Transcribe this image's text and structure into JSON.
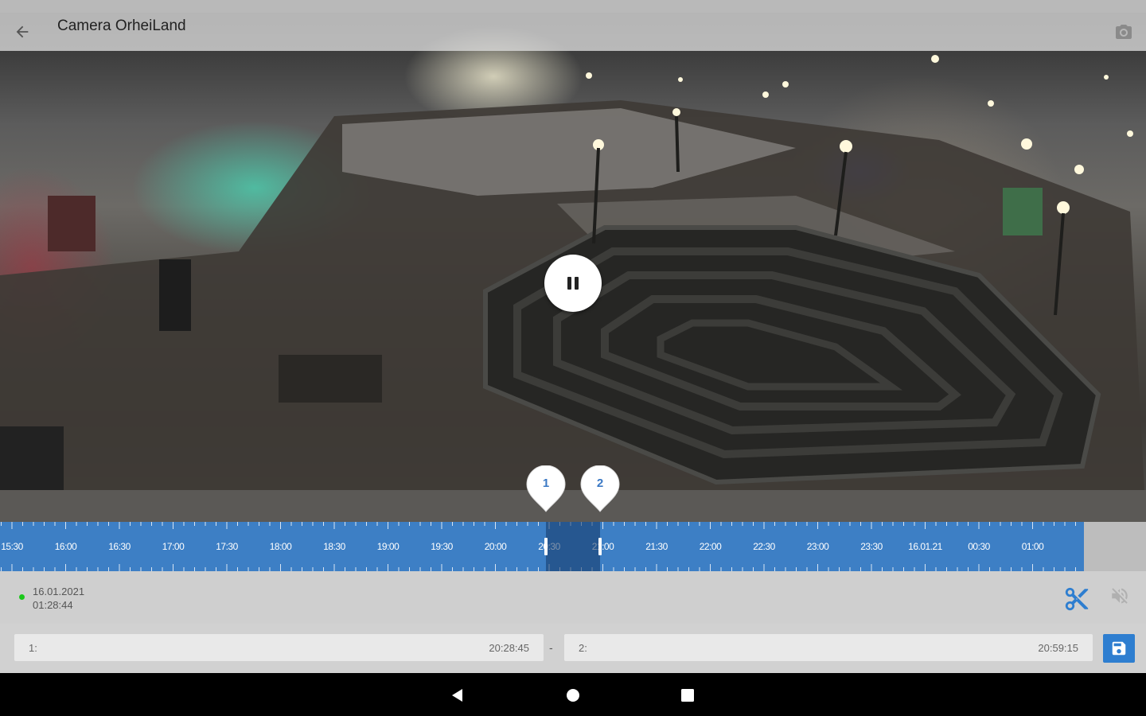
{
  "app_bar": {
    "title": "Camera OrheiLand",
    "back_icon": "arrow-back-icon",
    "snapshot_icon": "camera-icon"
  },
  "player": {
    "state_icon": "pause-icon",
    "markers": [
      {
        "label": "1"
      },
      {
        "label": "2"
      }
    ]
  },
  "timeline": {
    "accent": "#3d7fc5",
    "ticks": [
      "15:30",
      "16:00",
      "16:30",
      "17:00",
      "17:30",
      "18:00",
      "18:30",
      "19:00",
      "19:30",
      "20:00",
      "20:30",
      "21:00",
      "21:30",
      "22:00",
      "22:30",
      "23:00",
      "23:30",
      "16.01.21",
      "00:30",
      "01:00"
    ]
  },
  "info": {
    "date": "16.01.2021",
    "time": "01:28:44",
    "live_color": "#1bc81b",
    "cut_icon": "scissors-icon",
    "mute_icon": "volume-off-icon"
  },
  "range": {
    "start_label": "1:",
    "start_value": "20:28:45",
    "separator": "-",
    "end_label": "2:",
    "end_value": "20:59:15",
    "save_icon": "save-icon",
    "save_color": "#2e7ed0"
  },
  "nav": {
    "back_icon": "nav-back-icon",
    "home_icon": "nav-home-icon",
    "recents_icon": "nav-recents-icon"
  }
}
